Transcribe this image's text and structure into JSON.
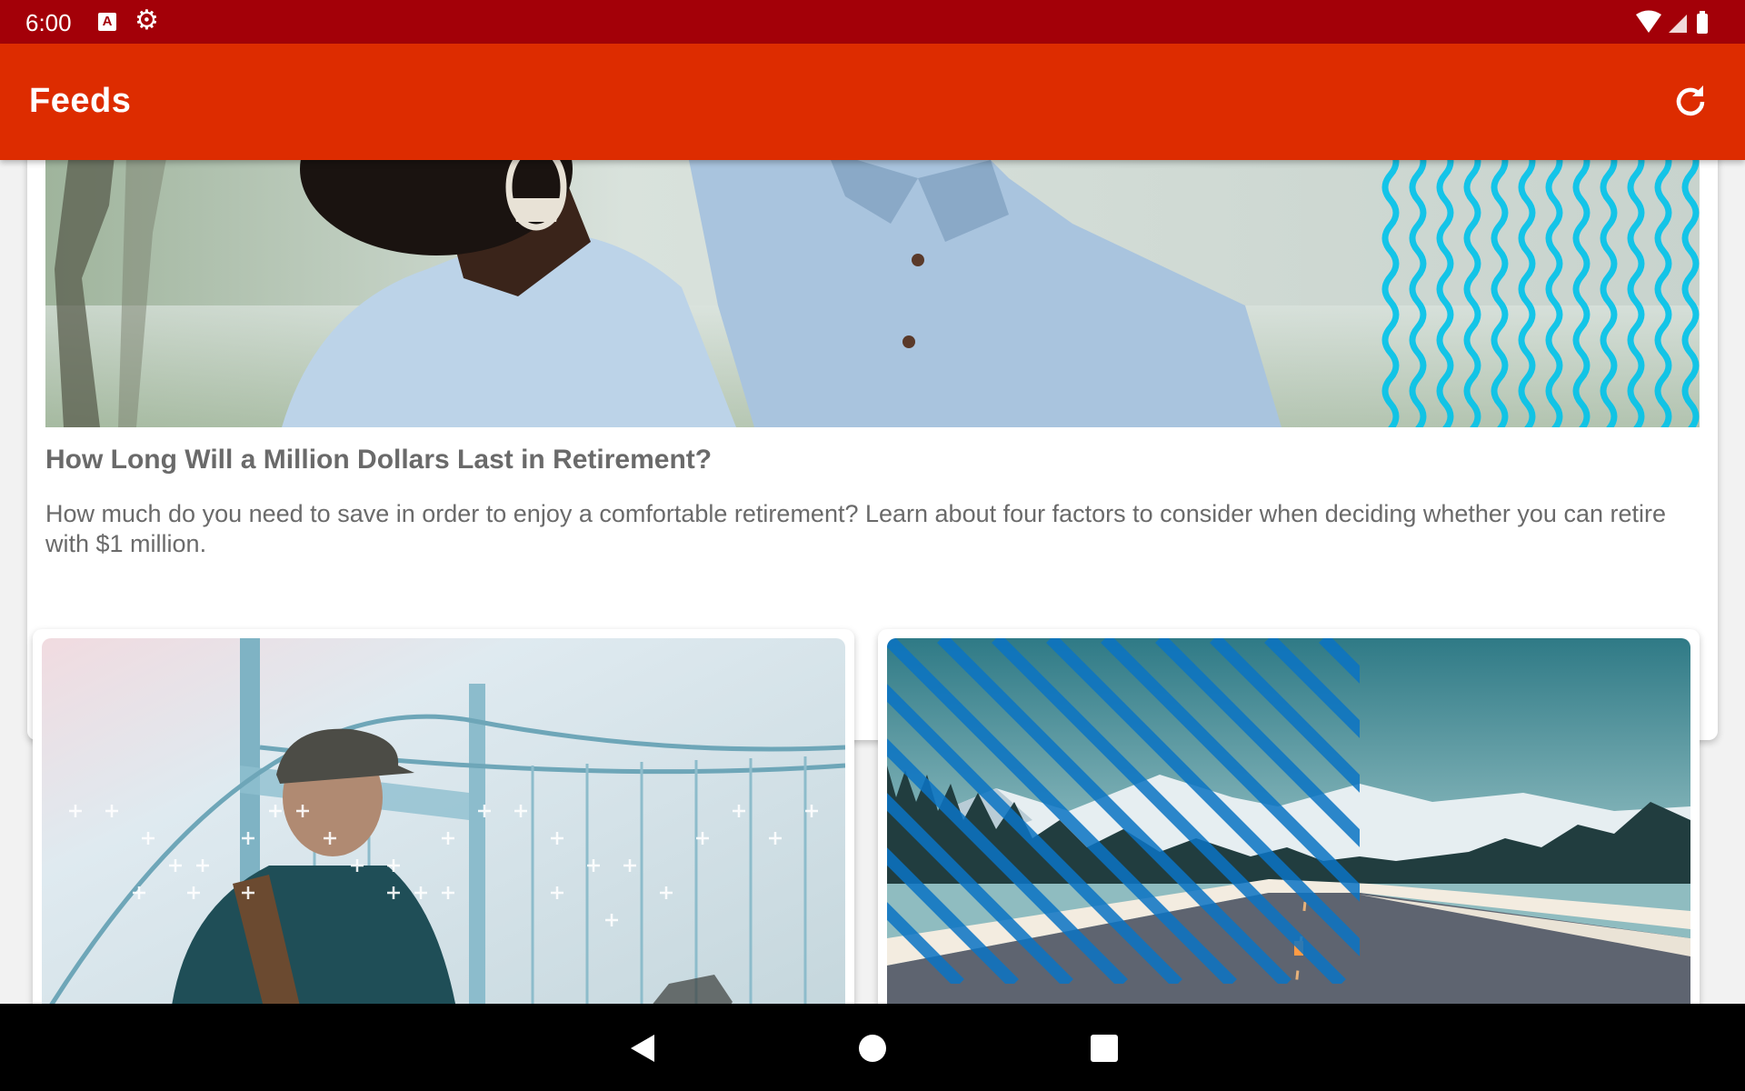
{
  "status_bar": {
    "time": "6:00",
    "left_icons": [
      "accessibility-a-icon",
      "settings-gear-icon"
    ],
    "right_icons": [
      "wifi-icon",
      "signal-icon",
      "battery-icon"
    ]
  },
  "app_bar": {
    "title": "Feeds",
    "action_icon": "refresh-icon"
  },
  "featured_article": {
    "title": "How Long Will a Million Dollars Last in Retirement?",
    "description": "How much do you need to save in order to enjoy a comfortable retirement? Learn about four factors to consider when deciding whether you can retire with $1 million.",
    "image_icon": "couple-photo"
  },
  "articles": [
    {
      "image_icon": "bridge-traveler-photo"
    },
    {
      "image_icon": "mountain-road-photo"
    }
  ],
  "nav_bar": {
    "buttons": [
      "back-icon",
      "home-icon",
      "recents-icon"
    ]
  },
  "colors": {
    "status_bar": "#a30008",
    "app_bar": "#dd2c00",
    "text_gray": "#6a6a6a",
    "accent_cyan": "#00c3ea",
    "stripe_blue": "#0b74c4"
  }
}
